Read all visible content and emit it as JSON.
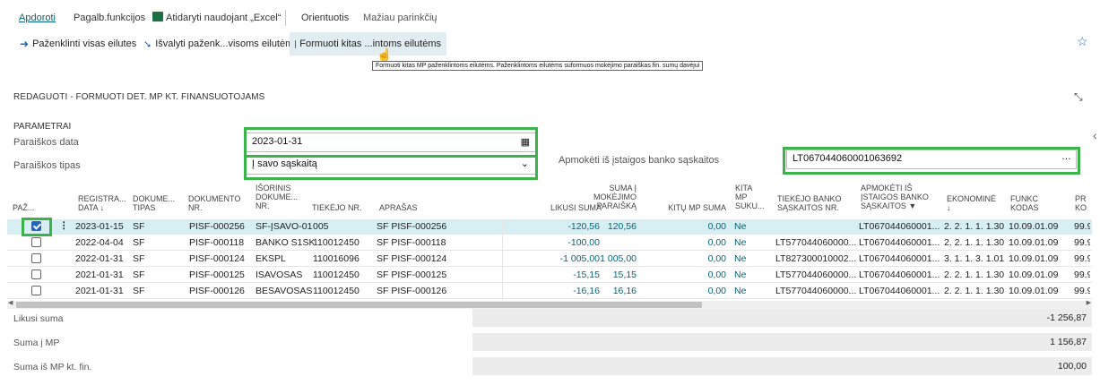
{
  "nav": {
    "items": [
      "Apdoroti",
      "Pagalb.funkcijos",
      "Atidaryti naudojant „Excel“",
      "Orientuotis",
      "Mažiau parinkčių"
    ]
  },
  "toolbar": {
    "mark_all": "Paženklinti visas eilutes",
    "clear_marks": "Išvalyti paženk...visoms eilutėms",
    "form_other": "Formuoti kitas ...intoms eilutėms"
  },
  "tooltip": "Formuoti kitas MP paženklintoms eilutėms. Paženklintoms eilutėms suformuos mokėjimo paraiškas fin. sumų davėjui",
  "page": {
    "title": "REDAGUOTI - FORMUOTI DET. MP KT. FINANSUOTOJAMS"
  },
  "params": {
    "section_title": "PARAMETRAI",
    "date_label": "Paraiškos data",
    "date_value": "2023-01-31",
    "type_label": "Paraiškos tipas",
    "type_value": "Į savo sąskaitą",
    "bank_label": "Apmokėti iš įstaigos banko sąskaitos",
    "bank_value": "LT067044060001063692"
  },
  "grid": {
    "headers": {
      "paz": "PAŽ...",
      "reg_date": [
        "REGISTRA...",
        "DATA ↓"
      ],
      "doc_type": [
        "DOKUME...",
        "TIPAS"
      ],
      "doc_no": [
        "DOKUMENTO",
        "NR."
      ],
      "ext_doc": [
        "IŠORINIS",
        "DOKUME...",
        "NR."
      ],
      "vendor": "TIEKĖJO NR.",
      "desc": "APRAŠAS",
      "remaining": "LIKUSI SUMA",
      "mp_sum": [
        "SUMA Į",
        "MOKĖJIMO",
        "PARAIŠKĄ"
      ],
      "other_mp": "KITŲ MP SUMA",
      "other_mp_created": [
        "KITA",
        "MP",
        "SUKU..."
      ],
      "vendor_bank": [
        "TIEKĖJO BANKO",
        "SĄSKAITOS NR."
      ],
      "pay_from": [
        "APMOKĖTI IŠ",
        "ĮSTAIGOS BANKO",
        "SĄSKAITOS"
      ],
      "economic": [
        "EKONOMINĖ",
        "↓"
      ],
      "func": [
        "FUNKC",
        "KODAS"
      ],
      "pr": [
        "PR",
        "KO"
      ]
    },
    "rows": [
      {
        "checked": true,
        "date": "2023-01-15",
        "type": "SF",
        "doc": "PISF-000256",
        "ext": "SF-ĮSAVO-01",
        "vendor": "005",
        "desc": "SF PISF-000256",
        "remaining": "-120,56",
        "mp_sum": "120,56",
        "other": "0,00",
        "created": "Ne",
        "vbank": "",
        "from": "LT067044060001...",
        "econ": "2. 2. 1. 1. 1.30",
        "func": "10.09.01.09",
        "pr": "99.9"
      },
      {
        "checked": false,
        "date": "2022-04-04",
        "type": "SF",
        "doc": "PISF-000118",
        "ext": "BANKO S1SK",
        "vendor": "110012450",
        "desc": "SF PISF-000118",
        "remaining": "-100,00",
        "mp_sum": "",
        "other": "0,00",
        "created": "Ne",
        "vbank": "LT577044060000...",
        "from": "LT067044060001...",
        "econ": "2. 2. 1. 1. 1.30",
        "func": "10.09.01.09",
        "pr": "99.9"
      },
      {
        "checked": false,
        "date": "2022-01-31",
        "type": "SF",
        "doc": "PISF-000124",
        "ext": "EKSPL",
        "vendor": "110016096",
        "desc": "SF PISF-000124",
        "remaining": "-1 005,00",
        "mp_sum": "1 005,00",
        "other": "0,00",
        "created": "Ne",
        "vbank": "LT827300010002...",
        "from": "LT067044060001...",
        "econ": "3. 1. 1. 3. 1.01",
        "func": "10.09.01.09",
        "pr": "99.9"
      },
      {
        "checked": false,
        "date": "2021-01-31",
        "type": "SF",
        "doc": "PISF-000125",
        "ext": "ISAVOSAS",
        "vendor": "110012450",
        "desc": "SF PISF-000125",
        "remaining": "-15,15",
        "mp_sum": "15,15",
        "other": "0,00",
        "created": "Ne",
        "vbank": "LT577044060000...",
        "from": "LT067044060001...",
        "econ": "2. 2. 1. 1. 1.30",
        "func": "10.09.01.09",
        "pr": "99.9"
      },
      {
        "checked": false,
        "date": "2021-01-31",
        "type": "SF",
        "doc": "PISF-000126",
        "ext": "BESAVOSAS",
        "vendor": "110012450",
        "desc": "SF PISF-000126",
        "remaining": "-16,16",
        "mp_sum": "16,16",
        "other": "0,00",
        "created": "Ne",
        "vbank": "LT577044060000...",
        "from": "LT067044060001...",
        "econ": "2. 2. 1. 1. 1.30",
        "func": "10.09.01.09",
        "pr": "99.9"
      }
    ]
  },
  "totals": {
    "remaining_label": "Likusi suma",
    "remaining_value": "-1 256,87",
    "mp_label": "Suma į MP",
    "mp_value": "1 156,87",
    "other_label": "Suma iš MP kt. fin.",
    "other_value": "100,00"
  }
}
